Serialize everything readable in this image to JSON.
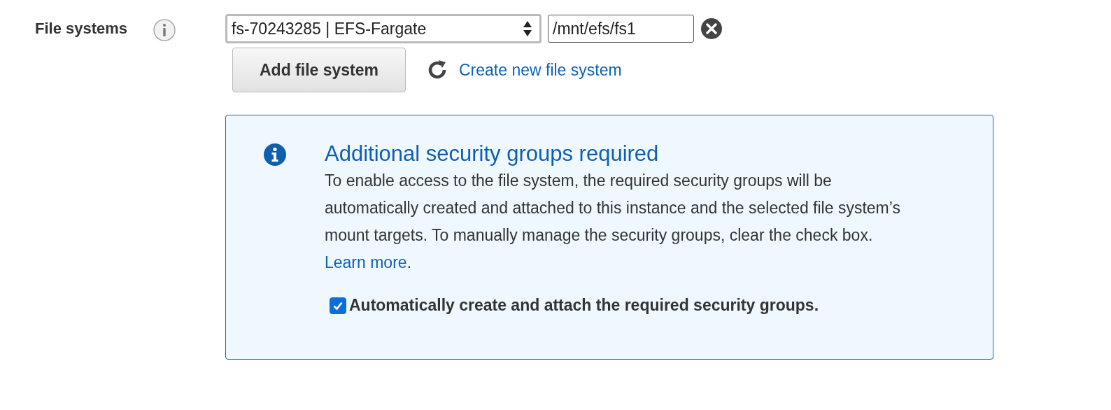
{
  "field": {
    "label": "File systems",
    "select_value": "fs-70243285 | EFS-Fargate",
    "mount_path": "/mnt/efs/fs1",
    "add_button": "Add file system",
    "create_link": "Create new file system"
  },
  "notice": {
    "title": "Additional security groups required",
    "body": "To enable access to the file system, the required security groups will be automatically created and attached to this instance and the selected file system’s mount targets. To manually manage the security groups, clear the check box.",
    "link": "Learn more",
    "body_end": ".",
    "checkbox": {
      "label": "Automatically create and attach the required security groups.",
      "checked": true
    }
  }
}
